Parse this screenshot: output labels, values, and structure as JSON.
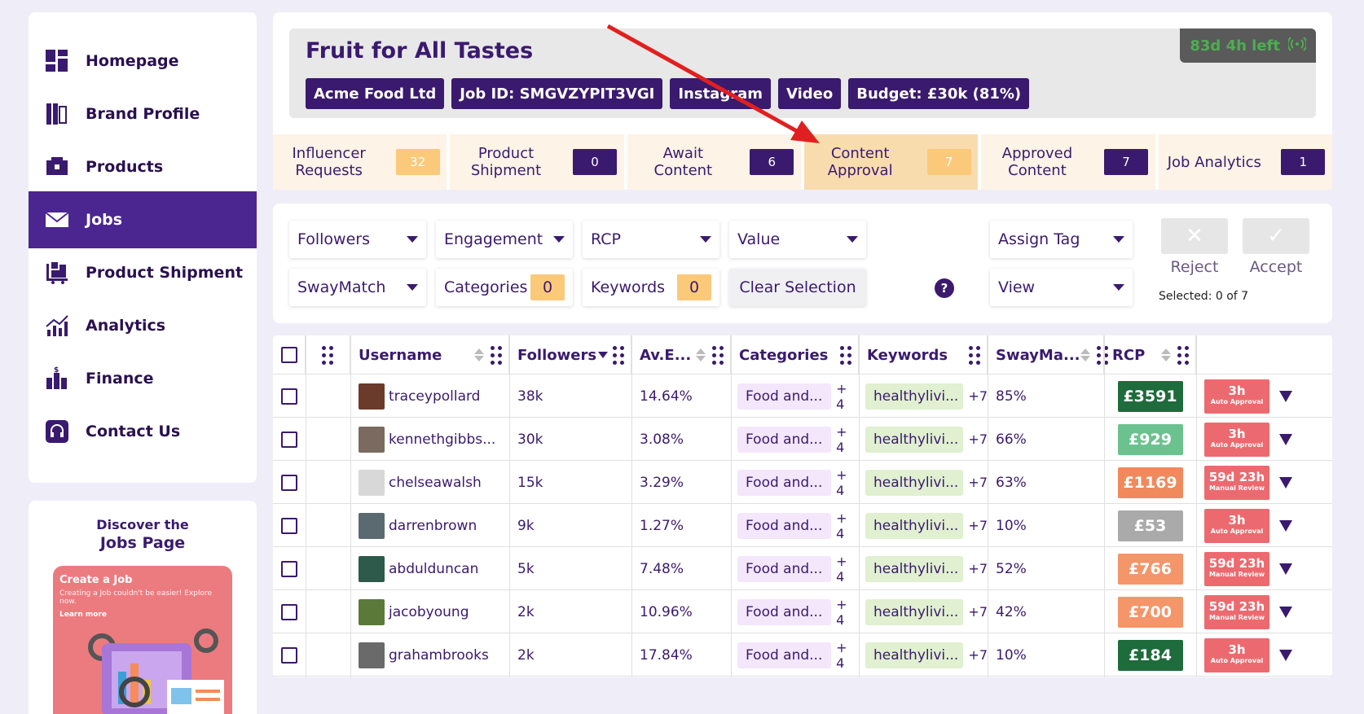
{
  "sidebar": {
    "items": [
      {
        "label": "Homepage",
        "icon": "dashboard-icon"
      },
      {
        "label": "Brand Profile",
        "icon": "brand-icon"
      },
      {
        "label": "Products",
        "icon": "products-icon"
      },
      {
        "label": "Jobs",
        "icon": "mail-icon",
        "active": true
      },
      {
        "label": "Product Shipment",
        "icon": "shipment-icon"
      },
      {
        "label": "Analytics",
        "icon": "analytics-icon"
      },
      {
        "label": "Finance",
        "icon": "finance-icon"
      },
      {
        "label": "Contact Us",
        "icon": "headset-icon"
      }
    ]
  },
  "promo": {
    "line1": "Discover the",
    "line2": "Jobs Page",
    "card_title": "Create a Job",
    "card_text": "Creating a Job couldn't be easier! Explore now.",
    "card_link": "Learn more"
  },
  "job": {
    "title": "Fruit for All Tastes",
    "tags": [
      "Acme Food Ltd",
      "Job ID: SMGVZYPIT3VGI",
      "Instagram",
      "Video",
      "Budget: £30k (81%)"
    ],
    "timer": "83d 4h left"
  },
  "tabs": [
    {
      "label": "Influencer Requests",
      "count": "32",
      "style": "orange"
    },
    {
      "label": "Product Shipment",
      "count": "0",
      "style": "dark"
    },
    {
      "label": "Await Content",
      "count": "6",
      "style": "dark"
    },
    {
      "label": "Content Approval",
      "count": "7",
      "style": "orange",
      "active": true
    },
    {
      "label": "Approved Content",
      "count": "7",
      "style": "dark"
    },
    {
      "label": "Job Analytics",
      "count": "1",
      "style": "dark"
    }
  ],
  "filters": {
    "followers": "Followers",
    "engagement": "Engagement",
    "rcp": "RCP",
    "value": "Value",
    "assign_tag": "Assign Tag",
    "swaymatch": "SwayMatch",
    "categories": "Categories",
    "categories_count": "0",
    "keywords": "Keywords",
    "keywords_count": "0",
    "clear": "Clear Selection",
    "help": "?",
    "view": "View",
    "reject": "Reject",
    "accept": "Accept",
    "selected": "Selected: 0 of 7"
  },
  "table": {
    "headers": {
      "username": "Username",
      "followers": "Followers",
      "engagement": "Av.E...",
      "categories": "Categories",
      "keywords": "Keywords",
      "swaymatch": "SwayMa...",
      "rcp": "RCP"
    },
    "rows": [
      {
        "username": "traceypollard",
        "followers": "38k",
        "engagement": "14.64%",
        "category": "Food and...",
        "cat_more": "+ 4",
        "keyword": "healthylivi...",
        "kw_more": "+7",
        "match": "85%",
        "rcp": "£3591",
        "rcp_color": "#1e6b3c",
        "status_time": "3h",
        "status_type": "Auto Approval",
        "avatar_color": "#6a3a2a"
      },
      {
        "username": "kennethgibbs...",
        "followers": "30k",
        "engagement": "3.08%",
        "category": "Food and...",
        "cat_more": "+ 4",
        "keyword": "healthylivi...",
        "kw_more": "+7",
        "match": "66%",
        "rcp": "£929",
        "rcp_color": "#6cc28f",
        "status_time": "3h",
        "status_type": "Auto Approval",
        "avatar_color": "#7a6a60"
      },
      {
        "username": "chelseawalsh",
        "followers": "15k",
        "engagement": "3.29%",
        "category": "Food and...",
        "cat_more": "+ 4",
        "keyword": "healthylivi...",
        "kw_more": "+7",
        "match": "63%",
        "rcp": "£1169",
        "rcp_color": "#f08a5d",
        "status_time": "59d 23h",
        "status_type": "Manual Review",
        "avatar_color": "#d8d8d8"
      },
      {
        "username": "darrenbrown",
        "followers": "9k",
        "engagement": "1.27%",
        "category": "Food and...",
        "cat_more": "+ 4",
        "keyword": "healthylivi...",
        "kw_more": "+7",
        "match": "10%",
        "rcp": "£53",
        "rcp_color": "#aaaaaa",
        "status_time": "3h",
        "status_type": "Auto Approval",
        "avatar_color": "#5a6a70"
      },
      {
        "username": "abdulduncan",
        "followers": "5k",
        "engagement": "7.48%",
        "category": "Food and...",
        "cat_more": "+ 4",
        "keyword": "healthylivi...",
        "kw_more": "+7",
        "match": "52%",
        "rcp": "£766",
        "rcp_color": "#f4956a",
        "status_time": "59d 23h",
        "status_type": "Manual Review",
        "avatar_color": "#2d5a4a"
      },
      {
        "username": "jacobyoung",
        "followers": "2k",
        "engagement": "10.96%",
        "category": "Food and...",
        "cat_more": "+ 4",
        "keyword": "healthylivi...",
        "kw_more": "+7",
        "match": "42%",
        "rcp": "£700",
        "rcp_color": "#f4956a",
        "status_time": "59d 23h",
        "status_type": "Manual Review",
        "avatar_color": "#5a7a3a"
      },
      {
        "username": "grahambrooks",
        "followers": "2k",
        "engagement": "17.84%",
        "category": "Food and...",
        "cat_more": "+ 4",
        "keyword": "healthylivi...",
        "kw_more": "+7",
        "match": "10%",
        "rcp": "£184",
        "rcp_color": "#1e6b3c",
        "status_time": "3h",
        "status_type": "Auto Approval",
        "avatar_color": "#6a6a6a"
      }
    ]
  },
  "colors": {
    "brand": "#3a1a6e",
    "active_nav": "#4b2590",
    "tab_active": "#f9dcae",
    "annotation_arrow": "#e02020"
  }
}
